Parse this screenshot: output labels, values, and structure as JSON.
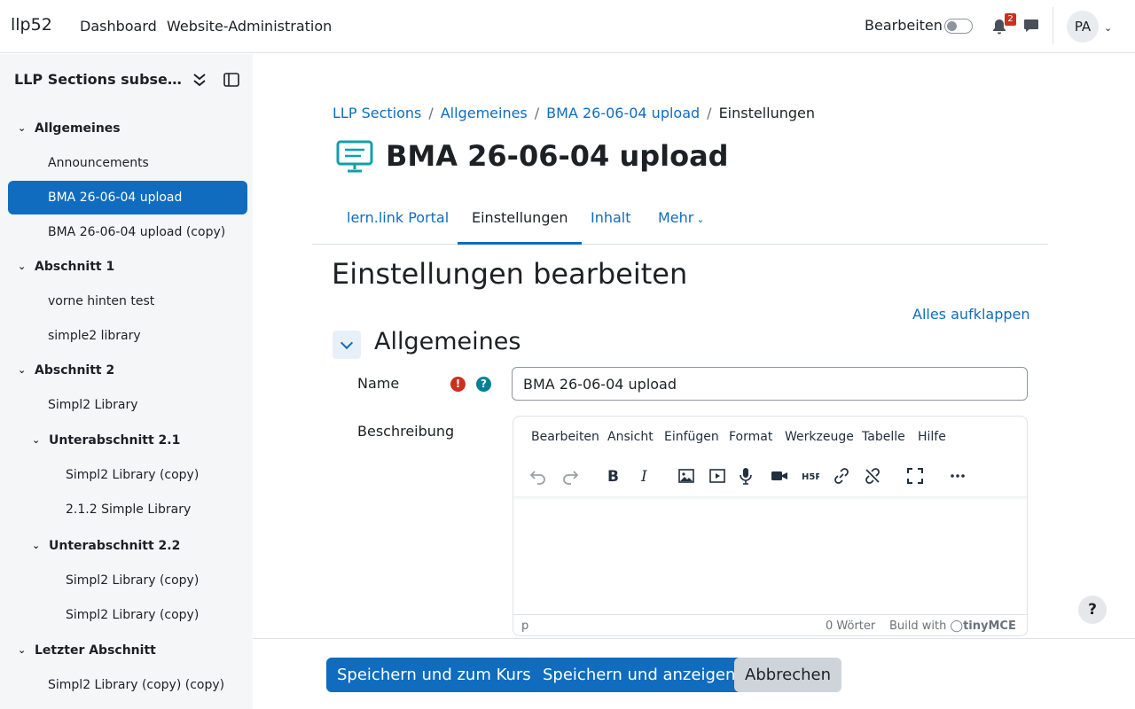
{
  "navbar": {
    "brand": "llp52",
    "links": [
      "Dashboard",
      "Website-Administration"
    ],
    "edit_mode_label": "Bearbeiten",
    "notification_count": "2",
    "user_initials": "PA"
  },
  "sidebar": {
    "title": "LLP Sections subsections",
    "items": [
      {
        "label": "Allgemeines",
        "type": "section"
      },
      {
        "label": "Announcements",
        "type": "activity"
      },
      {
        "label": "BMA 26-06-04 upload",
        "type": "activity",
        "active": true
      },
      {
        "label": "BMA 26-06-04 upload (copy)",
        "type": "activity"
      },
      {
        "label": "Abschnitt 1",
        "type": "section"
      },
      {
        "label": "vorne hinten test",
        "type": "activity"
      },
      {
        "label": "simple2 library",
        "type": "activity"
      },
      {
        "label": "Abschnitt 2",
        "type": "section"
      },
      {
        "label": "Simpl2 Library",
        "type": "activity"
      },
      {
        "label": "Unterabschnitt 2.1",
        "type": "subsection"
      },
      {
        "label": "Simpl2 Library (copy)",
        "type": "subactivity"
      },
      {
        "label": "2.1.2 Simple Library",
        "type": "subactivity"
      },
      {
        "label": "Unterabschnitt 2.2",
        "type": "subsection"
      },
      {
        "label": "Simpl2 Library (copy)",
        "type": "subactivity"
      },
      {
        "label": "Simpl2 Library (copy)",
        "type": "subactivity"
      },
      {
        "label": "Letzter Abschnitt",
        "type": "section"
      },
      {
        "label": "Simpl2 Library (copy) (copy)",
        "type": "activity"
      }
    ]
  },
  "breadcrumb": {
    "items": [
      "LLP Sections",
      "Allgemeines",
      "BMA 26-06-04 upload"
    ],
    "current": "Einstellungen"
  },
  "page": {
    "title": "BMA 26-06-04 upload",
    "icon": "monitor-icon"
  },
  "tabs": {
    "items": [
      "lern.link Portal",
      "Einstellungen",
      "Inhalt",
      "Mehr"
    ],
    "active": "Einstellungen"
  },
  "form": {
    "heading": "Einstellungen bearbeiten",
    "expand_all": "Alles aufklappen",
    "section_title": "Allgemeines",
    "name_label": "Name",
    "name_value": "BMA 26-06-04 upload",
    "description_label": "Beschreibung"
  },
  "editor": {
    "menu": [
      "Bearbeiten",
      "Ansicht",
      "Einfügen",
      "Format",
      "Werkzeuge",
      "Tabelle",
      "Hilfe"
    ],
    "status_path": "p",
    "word_count": "0 Wörter",
    "build_with": "Build with",
    "brand": "tinyMCE"
  },
  "footer": {
    "save_return": "Speichern und zum Kurs",
    "save_display": "Speichern und anzeigen",
    "cancel": "Abbrechen"
  },
  "help_fab": "?",
  "colors": {
    "primary": "#0f6cbf",
    "required": "#ca3120",
    "help": "#008196",
    "sidebar_bg": "#f5f6f7"
  }
}
